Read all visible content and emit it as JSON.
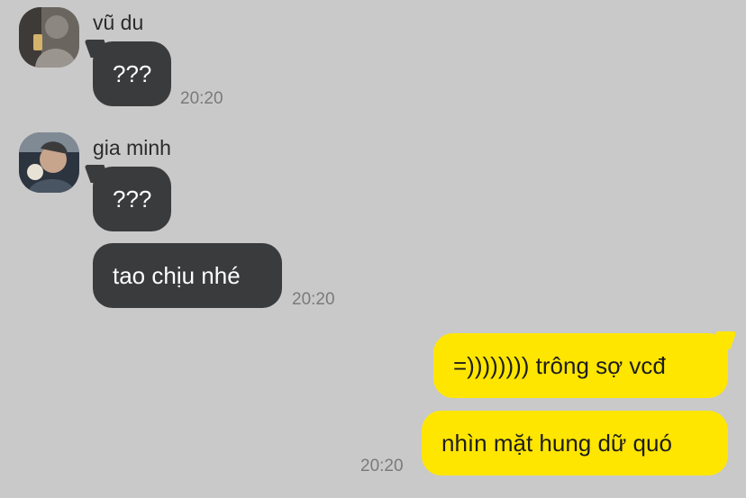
{
  "messages": [
    {
      "sender": "vũ du",
      "bubbles": [
        "???"
      ],
      "time": "20:20"
    },
    {
      "sender": "gia minh",
      "bubbles": [
        "???",
        "tao chịu nhé"
      ],
      "time": "20:20"
    },
    {
      "sender": "me",
      "bubbles": [
        "=)))))))) trông sợ vcđ",
        "nhìn mặt hung dữ quó"
      ],
      "time": "20:20"
    }
  ],
  "colors": {
    "background": "#c9c9c9",
    "incoming_bubble": "#3a3b3d",
    "outgoing_bubble": "#ffe600",
    "timestamp": "#7a7a7a"
  }
}
